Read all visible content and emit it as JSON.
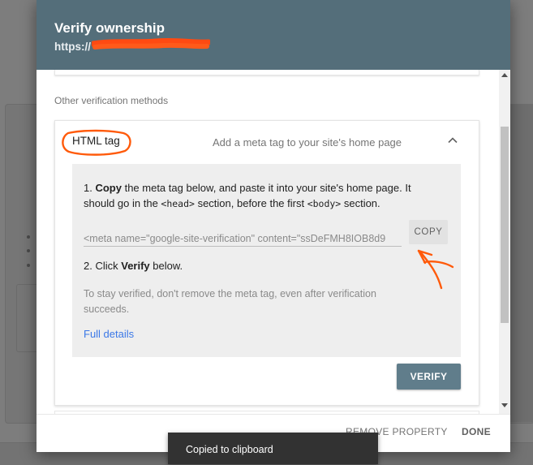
{
  "dialog": {
    "title": "Verify ownership",
    "url": "https://"
  },
  "section_label": "Other verification methods",
  "method": {
    "name": "HTML tag",
    "description": "Add a meta tag to your site's home page",
    "collapse_icon": "chevron-up-icon"
  },
  "instructions": {
    "step1_prefix": "1. ",
    "step1_bold": "Copy",
    "step1_text": " the meta tag below, and paste it into your site's home page. It should go in the ",
    "step1_code1": "<head>",
    "step1_mid": " section, before the first ",
    "step1_code2": "<body>",
    "step1_end": " section.",
    "meta_tag_value": "<meta name=\"google-site-verification\" content=\"ssDeFMH8IOB8d9",
    "copy_label": "COPY",
    "step2_prefix": "2. Click ",
    "step2_bold": "Verify",
    "step2_suffix": " below.",
    "stay_note": "To stay verified, don't remove the meta tag, even after verification succeeds.",
    "full_details": "Full details"
  },
  "verify_label": "VERIFY",
  "footer": {
    "remove_label": "REMOVE PROPERTY",
    "done_label": "DONE"
  },
  "snackbar": {
    "message": "Copied to clipboard"
  },
  "colors": {
    "header": "#546e7a",
    "verify_button": "#607d8b",
    "link": "#3b78e7",
    "annotation": "#ff5a0a"
  }
}
